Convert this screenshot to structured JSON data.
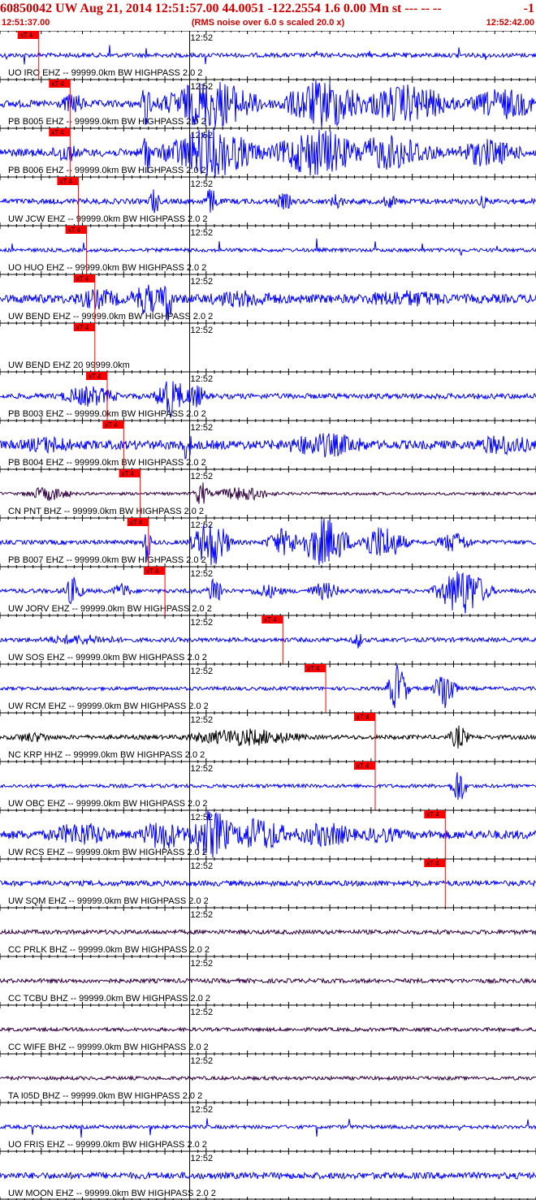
{
  "header": {
    "title_left": "60850042 UW Aug 21, 2014 12:51:57.00   44.0051 -122.2554  1.6 0.00 Mn st --- -- --",
    "title_right": "-1",
    "start_time": "12:51:37.00",
    "note": "(RMS noise over 6.0 s scaled 20.0 x)",
    "end_time": "12:52:42.00"
  },
  "colors": {
    "trace_blue": "#0000ff",
    "trace_dark": "#300040",
    "trace_black": "#000000",
    "pick_red": "#ff0000",
    "header_red": "#cc0000",
    "grid": "#000000"
  },
  "chart_data": {
    "type": "seismogram",
    "x_start": "12:51:37.00",
    "x_end": "12:52:42.00",
    "minute_label": "12:52",
    "pick_label": "xT 4",
    "traces": [
      {
        "label": "UO IRO EHZ -- 99999.0km BW  HIGHPASS  2.0  2",
        "color": "blue",
        "amp": 0.12,
        "pick": "12:51:41.7",
        "style": "spiky",
        "events": [
          [
            8,
            0.5,
            0.6
          ],
          [
            30,
            0.8,
            0.5
          ],
          [
            97,
            0.9,
            0.5
          ],
          [
            135,
            1.0,
            0.6
          ],
          [
            180,
            0.8,
            0.5
          ],
          [
            200,
            0.7,
            0.5
          ],
          [
            253,
            0.7,
            0.4
          ],
          [
            390,
            0.6,
            0.5
          ],
          [
            455,
            0.6,
            0.4
          ],
          [
            500,
            0.7,
            0.4
          ],
          [
            565,
            0.8,
            0.8
          ],
          [
            598,
            0.8,
            0.5
          ]
        ]
      },
      {
        "label": "PB B005 EHZ -- 99999.0km BW  HIGHPASS  2.0  2",
        "color": "blue",
        "amp": 0.2,
        "pick": "12:51:45.5",
        "style": "burst",
        "events": [
          [
            90,
            0.6,
            12
          ],
          [
            180,
            1.4,
            4
          ],
          [
            260,
            1.4,
            40
          ],
          [
            400,
            1.4,
            35
          ],
          [
            500,
            1.1,
            40
          ],
          [
            620,
            0.9,
            30
          ]
        ]
      },
      {
        "label": "PB B006 EHZ -- 99999.0km BW  HIGHPASS  2.0  2",
        "color": "blue",
        "amp": 0.22,
        "pick": "12:51:45.5",
        "style": "burst",
        "events": [
          [
            80,
            0.6,
            12
          ],
          [
            180,
            1.4,
            4
          ],
          [
            260,
            1.4,
            40
          ],
          [
            390,
            1.4,
            35
          ],
          [
            480,
            1.0,
            40
          ],
          [
            600,
            0.8,
            30
          ]
        ]
      },
      {
        "label": "UW JCW EHZ -- 99999.0km BW  HIGHPASS  2.0  2",
        "color": "blue",
        "amp": 0.15,
        "pick": "12:51:46.5",
        "style": "burst",
        "events": [
          [
            190,
            0.9,
            4
          ],
          [
            260,
            0.8,
            6
          ],
          [
            350,
            0.5,
            8
          ],
          [
            415,
            0.5,
            6
          ],
          [
            480,
            0.4,
            8
          ],
          [
            595,
            0.4,
            5
          ]
        ]
      },
      {
        "label": "UO HUO EHZ -- 99999.0km BW  HIGHPASS  2.0  2",
        "color": "blue",
        "amp": 0.1,
        "pick": "12:51:47.5",
        "style": "spiky",
        "events": [
          [
            15,
            0.4,
            0.5
          ],
          [
            103,
            0.7,
            0.5
          ],
          [
            185,
            0.6,
            0.5
          ],
          [
            270,
            0.6,
            0.5
          ],
          [
            390,
            0.7,
            0.5
          ],
          [
            462,
            0.6,
            0.5
          ],
          [
            520,
            0.5,
            0.5
          ],
          [
            568,
            0.9,
            0.6
          ],
          [
            612,
            0.5,
            0.5
          ]
        ]
      },
      {
        "label": "UW BEND EHZ -- 99999.0km BW  HIGHPASS  2.0  2",
        "color": "blue",
        "amp": 0.25,
        "pick": "12:51:48.5",
        "style": "burst",
        "events": [
          [
            120,
            0.6,
            25
          ],
          [
            180,
            0.9,
            15
          ],
          [
            205,
            1.4,
            6
          ],
          [
            300,
            0.5,
            40
          ],
          [
            500,
            0.5,
            50
          ]
        ]
      },
      {
        "label": "UW BEND EHZ 20 99999.0km",
        "color": "blue",
        "amp": 0.0,
        "pick": "12:51:48.5",
        "style": "flat",
        "events": []
      },
      {
        "label": "PB B003 EHZ -- 99999.0km BW  HIGHPASS  2.0  2",
        "color": "blue",
        "amp": 0.15,
        "pick": "12:51:50.0",
        "style": "burst",
        "events": [
          [
            110,
            0.6,
            25
          ],
          [
            210,
            1.2,
            12
          ],
          [
            240,
            0.7,
            10
          ]
        ]
      },
      {
        "label": "PB B004 EHZ -- 99999.0km BW  HIGHPASS  2.0  2",
        "color": "blue",
        "amp": 0.25,
        "pick": "12:51:52.0",
        "style": "burst",
        "events": [
          [
            60,
            0.5,
            30
          ],
          [
            230,
            0.9,
            5
          ],
          [
            400,
            0.7,
            40
          ],
          [
            620,
            0.6,
            30
          ]
        ]
      },
      {
        "label": "CN PNT BHZ -- 99999.0km BW  HIGHPASS  2.0  2",
        "color": "dark",
        "amp": 0.08,
        "pick": "12:51:54.0",
        "style": "burst",
        "events": [
          [
            60,
            0.4,
            20
          ],
          [
            248,
            0.7,
            6
          ],
          [
            300,
            0.4,
            25
          ]
        ]
      },
      {
        "label": "PB B007 EHZ -- 99999.0km BW  HIGHPASS  2.0  2",
        "color": "blue",
        "amp": 0.12,
        "pick": "12:51:55.0",
        "style": "burst",
        "events": [
          [
            181,
            1.2,
            3
          ],
          [
            260,
            1.4,
            15
          ],
          [
            350,
            0.8,
            15
          ],
          [
            400,
            1.4,
            20
          ],
          [
            470,
            1.0,
            20
          ],
          [
            560,
            0.6,
            15
          ]
        ]
      },
      {
        "label": "UW JORV EHZ -- 99999.0km BW  HIGHPASS  2.0  2",
        "color": "blue",
        "amp": 0.12,
        "pick": "12:51:57.0",
        "style": "burst",
        "events": [
          [
            90,
            0.8,
            8
          ],
          [
            150,
            0.5,
            8
          ],
          [
            265,
            1.0,
            6
          ],
          [
            330,
            0.4,
            15
          ],
          [
            400,
            0.5,
            15
          ],
          [
            570,
            1.4,
            20
          ]
        ]
      },
      {
        "label": "UW SOS EHZ -- 99999.0km BW  HIGHPASS  2.0  2",
        "color": "blue",
        "amp": 0.12,
        "pick": "12:52:11.3",
        "style": "burst",
        "events": [
          [
            100,
            0.3,
            40
          ],
          [
            440,
            0.6,
            4
          ]
        ]
      },
      {
        "label": "UW RCM EHZ -- 99999.0km BW  HIGHPASS  2.0  2",
        "color": "blue",
        "amp": 0.1,
        "pick": "12:52:16.5",
        "style": "burst",
        "events": [
          [
            490,
            1.4,
            8
          ],
          [
            548,
            1.4,
            8
          ]
        ]
      },
      {
        "label": "NC KRP HHZ -- 99999.0km BW  HIGHPASS  2.0  2",
        "color": "black",
        "amp": 0.12,
        "pick": "12:52:22.5",
        "style": "burst",
        "events": [
          [
            40,
            0.3,
            20
          ],
          [
            300,
            0.5,
            50
          ],
          [
            565,
            0.7,
            8
          ]
        ]
      },
      {
        "label": "UW OBC EHZ -- 99999.0km BW  HIGHPASS  2.0  2",
        "color": "blue",
        "amp": 0.1,
        "pick": "12:52:22.5",
        "style": "burst",
        "events": [
          [
            565,
            1.1,
            6
          ]
        ]
      },
      {
        "label": "UW RCS EHZ -- 99999.0km BW  HIGHPASS  2.0  2",
        "color": "blue",
        "amp": 0.25,
        "pick": "12:52:31.0",
        "style": "burst",
        "events": [
          [
            100,
            0.7,
            30
          ],
          [
            200,
            0.9,
            20
          ],
          [
            260,
            1.4,
            20
          ],
          [
            320,
            1.0,
            25
          ],
          [
            400,
            0.7,
            30
          ],
          [
            470,
            0.5,
            20
          ]
        ]
      },
      {
        "label": "UW SQM EHZ -- 99999.0km BW  HIGHPASS  2.0  2",
        "color": "blue",
        "amp": 0.15,
        "pick": "12:52:31.0",
        "style": "burst",
        "events": []
      },
      {
        "label": "CC PRLK BHZ -- 99999.0km BW  HIGHPASS  2.0  2",
        "color": "dark",
        "amp": 0.12,
        "pick": null,
        "style": "burst",
        "events": []
      },
      {
        "label": "CC TCBU BHZ -- 99999.0km BW  HIGHPASS  2.0  2",
        "color": "dark",
        "amp": 0.12,
        "pick": null,
        "style": "burst",
        "events": []
      },
      {
        "label": "CC WIFE BHZ -- 99999.0km BW  HIGHPASS  2.0  2",
        "color": "dark",
        "amp": 0.1,
        "pick": null,
        "style": "burst",
        "events": []
      },
      {
        "label": "TA I05D BHZ -- 99999.0km BW  HIGHPASS  2.0  2",
        "color": "dark",
        "amp": 0.1,
        "pick": null,
        "style": "burst",
        "events": []
      },
      {
        "label": "UO FRIS EHZ -- 99999.0km BW  HIGHPASS  2.0  2",
        "color": "blue",
        "amp": 0.1,
        "pick": null,
        "style": "spiky",
        "events": [
          [
            8,
            0.5,
            0.6
          ],
          [
            40,
            0.6,
            0.5
          ],
          [
            100,
            0.6,
            0.5
          ],
          [
            185,
            0.6,
            0.5
          ],
          [
            255,
            0.5,
            0.5
          ],
          [
            390,
            0.6,
            0.5
          ],
          [
            430,
            0.8,
            0.6
          ],
          [
            470,
            0.6,
            0.5
          ],
          [
            520,
            0.6,
            0.5
          ],
          [
            565,
            0.9,
            0.6
          ],
          [
            598,
            0.6,
            0.5
          ],
          [
            650,
            0.5,
            0.5
          ]
        ]
      },
      {
        "label": "UW MOON EHZ -- 99999.0km BW  HIGHPASS  2.0  2",
        "color": "blue",
        "amp": 0.18,
        "pick": null,
        "style": "burst",
        "events": []
      }
    ]
  }
}
